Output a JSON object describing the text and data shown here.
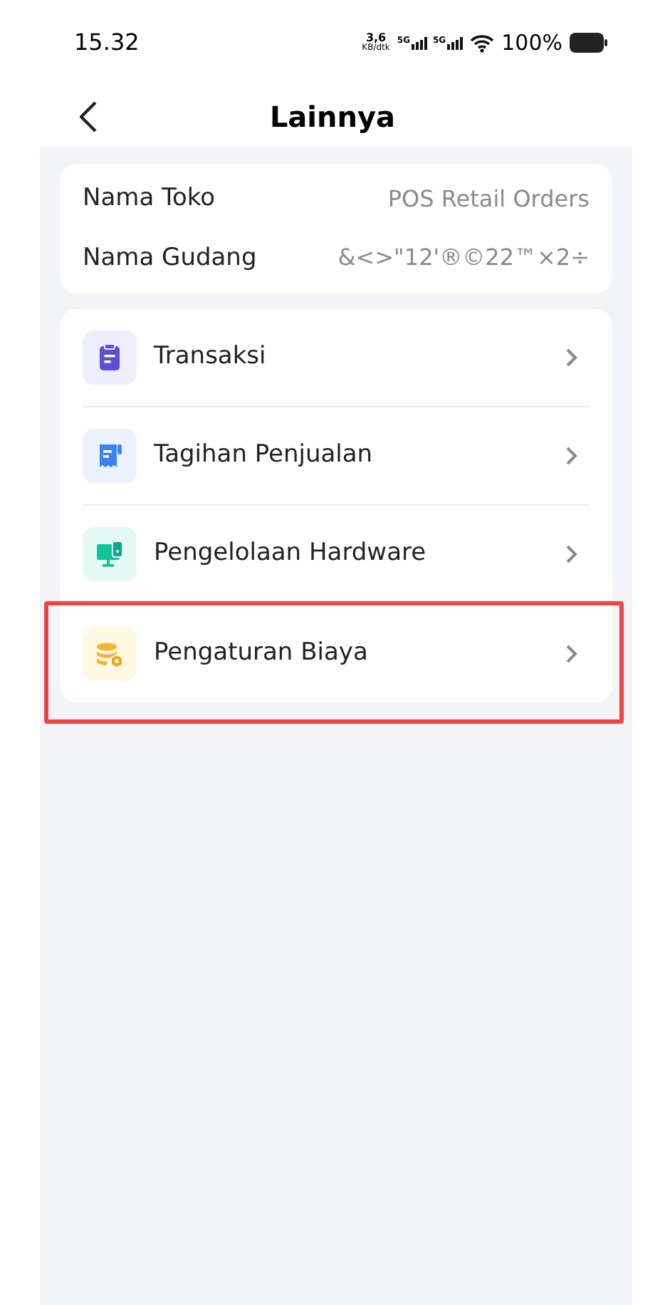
{
  "status_bar": {
    "time": "15.32",
    "speed_value": "3,6",
    "speed_unit": "KB/dtk",
    "networks": [
      "5G",
      "5G"
    ],
    "battery": "100%"
  },
  "header": {
    "title": "Lainnya"
  },
  "info": [
    {
      "label": "Nama Toko",
      "value": "POS Retail Orders"
    },
    {
      "label": "Nama Gudang",
      "value": "&<>\"12'®©22™×2÷"
    }
  ],
  "menu": [
    {
      "label": "Transaksi",
      "highlighted": false
    },
    {
      "label": "Tagihan Penjualan",
      "highlighted": false
    },
    {
      "label": "Pengelolaan Hardware",
      "highlighted": false
    },
    {
      "label": "Pengaturan Biaya",
      "highlighted": true
    }
  ]
}
